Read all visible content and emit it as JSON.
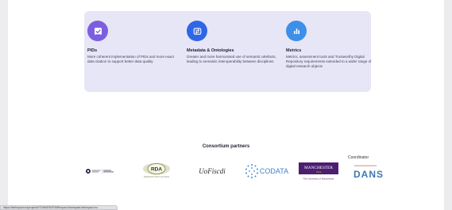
{
  "features": [
    {
      "title": "PIDs",
      "description": "More coherent implementation of PIDs and more exact data citation to support better data quality",
      "icon": "checkbox-document-icon",
      "color": "#7b5fe0"
    },
    {
      "title": "Metadata & Ontologies",
      "description": "Greater and more harmonised use of semantic artefacts, leading to semantic interoperability between disciplines",
      "icon": "sync-arrows-icon",
      "color": "#2f66e6"
    },
    {
      "title": "Metrics",
      "description": "Metrics, assessment tools and Trustworthy Digital Repository requirements extended to a wider range of digital research objects",
      "icon": "bar-chart-icon",
      "color": "#3d8fe8"
    }
  ],
  "partners": {
    "heading": "Consortium partners",
    "coordinator_label": "Coordinator",
    "logos": [
      {
        "name": "ui-research-infrastructure-logo",
        "text": "UK Research and Innovation"
      },
      {
        "name": "rda-logo",
        "text": "RDA",
        "subtext": "RESEARCH DATA ALLIANCE"
      },
      {
        "name": "ucfiscdi-logo",
        "text": "UoFiscdi"
      },
      {
        "name": "codata-logo",
        "text": "CODATA"
      },
      {
        "name": "manchester-logo",
        "text": "MANCHESTER",
        "year": "1824",
        "subtext": "The University of Manchester"
      },
      {
        "name": "dans-logo",
        "text": "DANS"
      }
    ]
  },
  "status_bar": {
    "url": "https://fairimpact.eu/project/#TOWARDSFAIRImpact-fairimpact-fairimpact-eu"
  }
}
